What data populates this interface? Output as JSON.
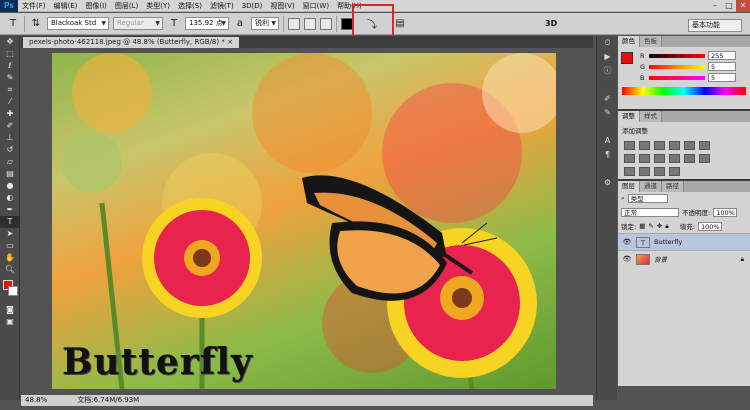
{
  "app": {
    "logo": "Ps",
    "colors": {
      "accent": "#31a8ff",
      "highlight": "#e0202a"
    }
  },
  "menu": [
    "文件(F)",
    "编辑(E)",
    "图像(I)",
    "图层(L)",
    "类型(Y)",
    "选择(S)",
    "滤镜(T)",
    "3D(D)",
    "视图(V)",
    "窗口(W)",
    "帮助(H)"
  ],
  "window_controls": {
    "minimize": "–",
    "maximize": "□",
    "close": "✕"
  },
  "options": {
    "font_family": "Blackoak Std",
    "font_style": "Regular",
    "font_size": "135.92 点",
    "antialias": "锐利",
    "label_3d": "3D",
    "workspace": "基本功能"
  },
  "document": {
    "tab_title": "pexels-photo-462118.jpeg @ 48.8% (Butterfly, RGB/8) *",
    "canvas_text": "Butterfly"
  },
  "status": {
    "zoom": "48.8%",
    "doc_size": "文档:6.74M/6.93M"
  },
  "color_panel": {
    "tabs": [
      "颜色",
      "色板"
    ],
    "channels": [
      {
        "name": "R",
        "value": "255"
      },
      {
        "name": "G",
        "value": "5"
      },
      {
        "name": "B",
        "value": "5"
      }
    ]
  },
  "adjust_panel": {
    "tabs": [
      "调整",
      "样式"
    ],
    "title": "添加调整"
  },
  "layers_panel": {
    "tabs": [
      "图层",
      "通道",
      "路径"
    ],
    "filter_label": "类型",
    "blend_mode": "正常",
    "opacity_label": "不透明度:",
    "opacity": "100%",
    "lock_label": "锁定:",
    "fill_label": "填充:",
    "fill": "100%",
    "layers": [
      {
        "name": "Butterfly",
        "type": "T"
      },
      {
        "name": "背景",
        "type": "img"
      }
    ]
  }
}
